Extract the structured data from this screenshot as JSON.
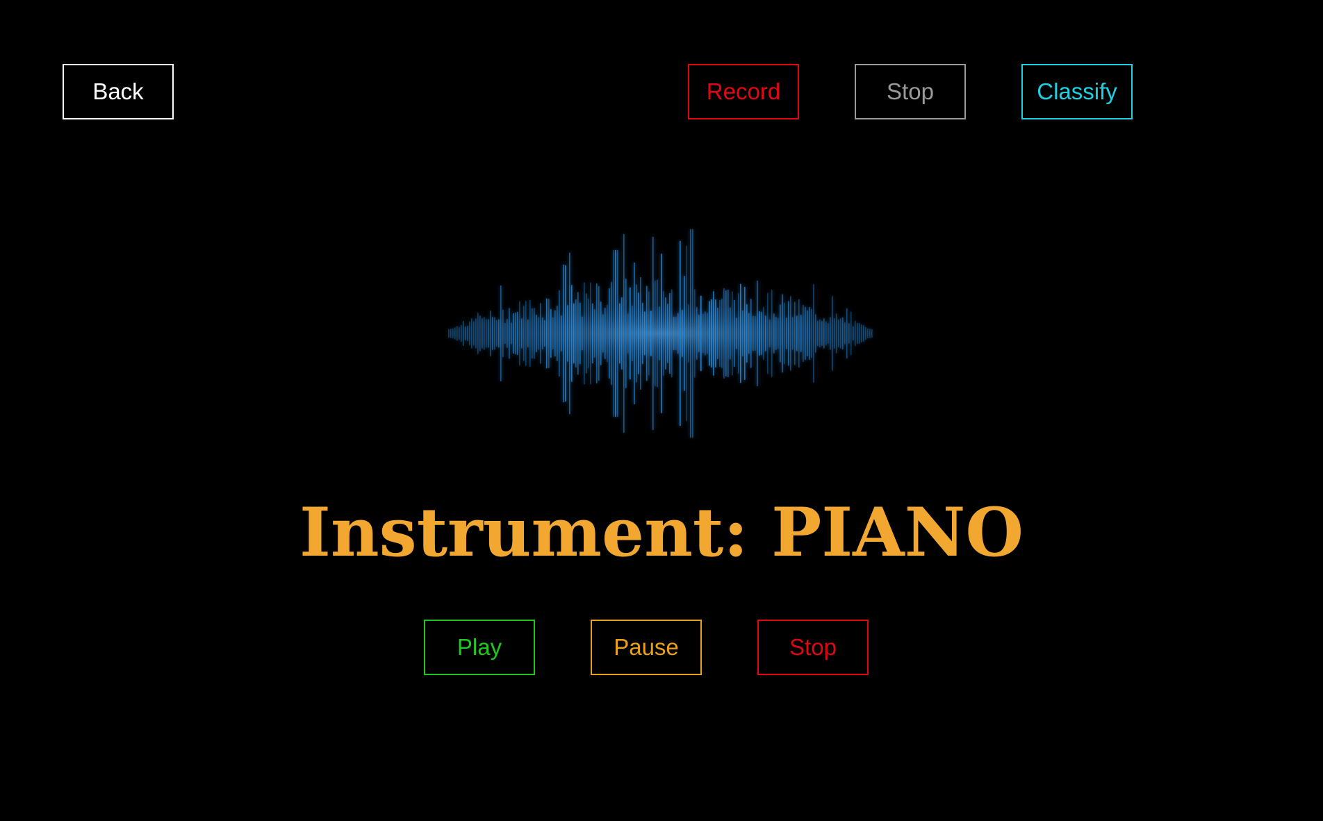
{
  "top_bar": {
    "back_label": "Back",
    "record_label": "Record",
    "stop_label": "Stop",
    "classify_label": "Classify"
  },
  "result": {
    "text": "Instrument: PIANO"
  },
  "playback": {
    "play_label": "Play",
    "pause_label": "Pause",
    "stop_label": "Stop"
  },
  "colors": {
    "background": "#000000",
    "back": "#ffffff",
    "record": "#e10613",
    "record_stop": "#9a9a9a",
    "classify": "#1fd0e0",
    "play": "#1ec81e",
    "pause": "#e8a21a",
    "playback_stop": "#e10613",
    "result_text": "#f2a830",
    "waveform": "#2e8fe0"
  },
  "waveform_icon": "sound-waveform-image"
}
